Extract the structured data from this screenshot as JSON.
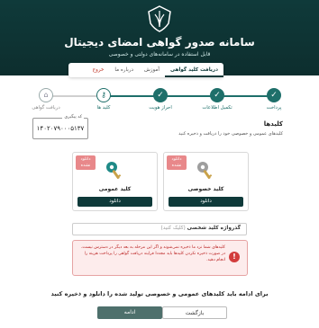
{
  "header": {
    "title": "سامانه صدور گواهی امضای دیجیتال",
    "subtitle": "قابل استفاده در سامانه‌های دولتی و خصوصی"
  },
  "tabs": [
    {
      "label": "دریافت کلید گواهی",
      "active": true
    },
    {
      "label": "آموزش"
    },
    {
      "label": "درباره ما"
    },
    {
      "label": "خروج"
    }
  ],
  "steps": [
    {
      "label": "پرداخت",
      "state": "done"
    },
    {
      "label": "تکمیل اطلاعات",
      "state": "done"
    },
    {
      "label": "احراز هویت",
      "state": "done"
    },
    {
      "label": "کلید ها",
      "state": "current"
    },
    {
      "label": "دریافت گواهی",
      "state": "pending"
    }
  ],
  "tracking": {
    "label": "کد پیگیری",
    "value": "۱۴۰۲۰۷۹۰۰۰۵۱۳۷"
  },
  "keys_section": {
    "title": "کلیدها",
    "description": "کلیدهای عمومی و خصوصی خود را دریافت و ذخیره کنید"
  },
  "public_key": {
    "badge": "دانلود نشده",
    "name": "کلید عمومی",
    "button": "دانلود"
  },
  "private_key": {
    "badge": "دانلود نشده",
    "name": "کلید خصوصی",
    "button": "دانلود"
  },
  "passphrase": {
    "label": "گذرواژه کلید شخصی",
    "hint": "(کلیک کنید)"
  },
  "alert": {
    "text": "کلیدهای شما نزد ما ذخیره نمی‌شوند و اگر این مرحله به بعد دیگر در دسترس نیست، در صورت ذخیره نکردن کلیدها باید مجددا فرایند دریافت گواهی را پرداخت هزینه را انجام دهید."
  },
  "footer": {
    "proceed_text": "برای ادامه باید کلیدهای عمومی و خصوصی تولید شده را دانلود و ذخیره کنید",
    "continue": "ادامه",
    "back": "بازگشت"
  },
  "colors": {
    "primary": "#0f3a3a",
    "accent": "#1e6f6a",
    "danger": "#d23c3c"
  },
  "icons": {
    "logo": "emblem-icon",
    "check": "check-icon",
    "key": "key-icon",
    "warning": "warning-icon"
  }
}
